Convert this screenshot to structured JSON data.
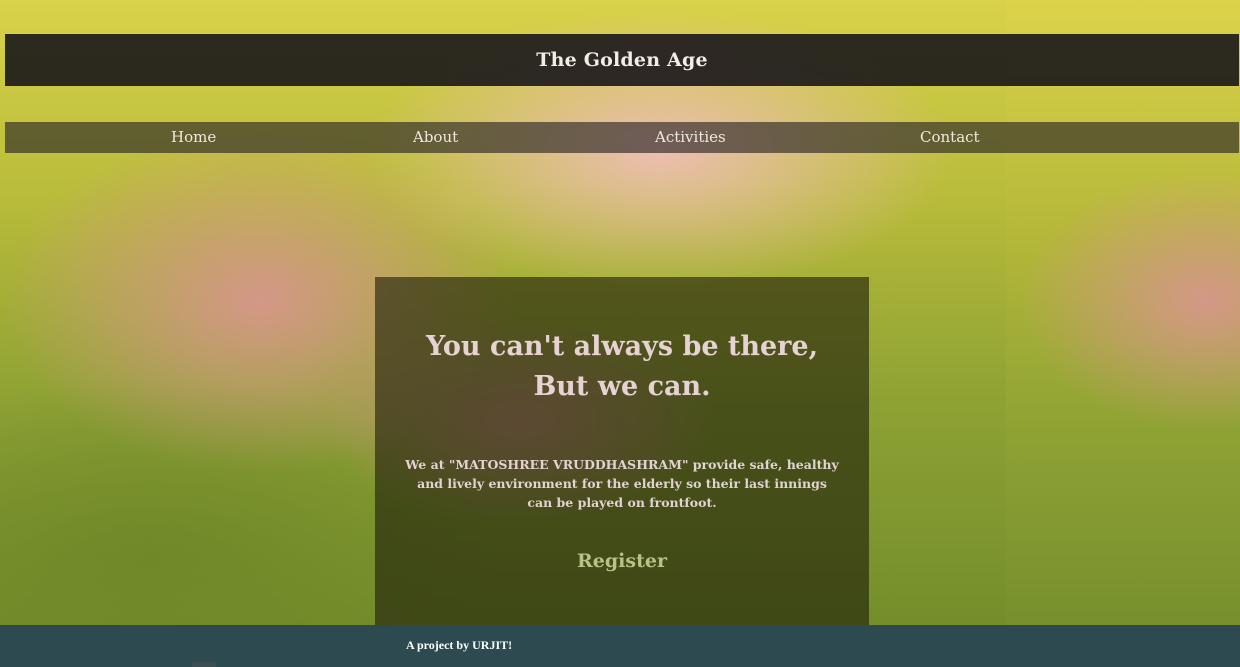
{
  "header": {
    "title": "The Golden Age"
  },
  "nav": {
    "items": [
      {
        "label": "Home"
      },
      {
        "label": "About"
      },
      {
        "label": "Activities"
      },
      {
        "label": "Contact"
      }
    ]
  },
  "hero": {
    "heading": "You can't always be there, But we can.",
    "description": "We at \"MATOSHREE VRUDDHASHRAM\" provide safe, healthy and lively environment for the elderly so their last innings can be played on frontfoot.",
    "register_label": "Register"
  },
  "footer": {
    "text": "A project by URJIT!"
  },
  "colors": {
    "header_bg": "#141219",
    "footer_bg": "#2c4a4f",
    "register_accent": "#b8c287"
  }
}
